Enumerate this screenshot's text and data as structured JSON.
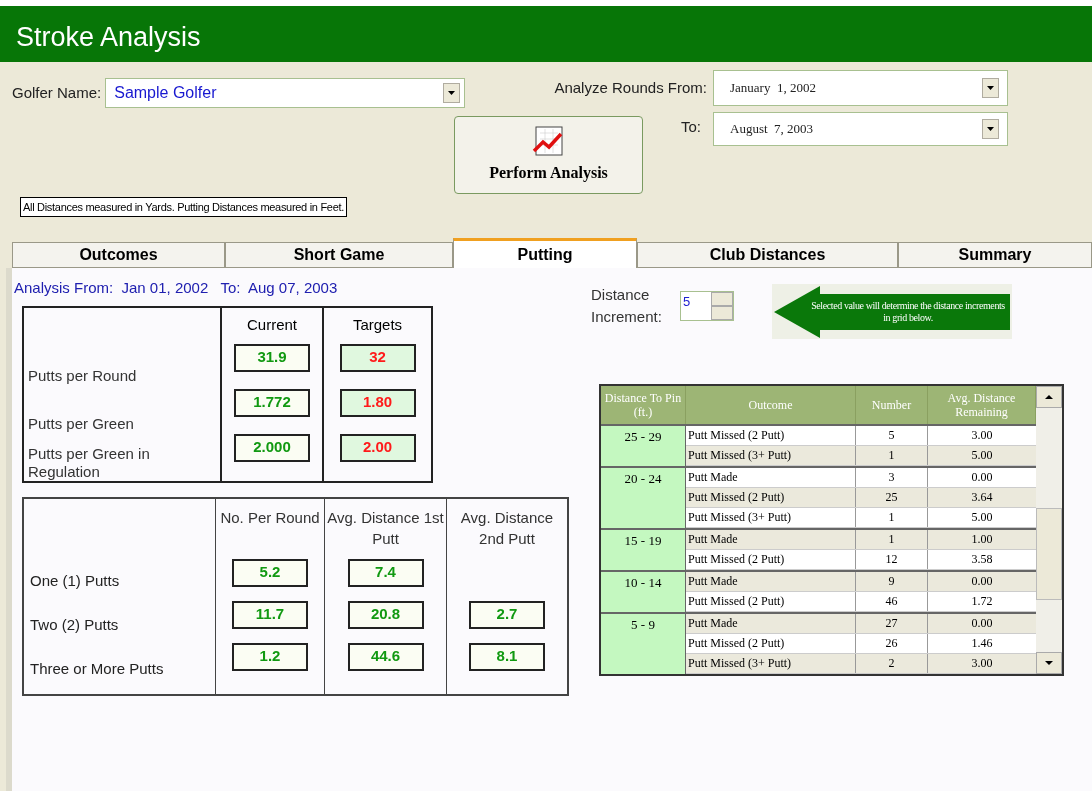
{
  "window": {
    "title": "Stroke Analysis"
  },
  "golfer": {
    "label": "Golfer Name:",
    "value": "Sample Golfer"
  },
  "range": {
    "from_label": "Analyze Rounds From:",
    "from_value": "January  1, 2002",
    "to_label": "To:",
    "to_value": "August  7, 2003"
  },
  "perform_button": "Perform Analysis",
  "note": "All Distances measured in Yards.  Putting Distances measured in Feet.",
  "tabs": [
    {
      "label": "Outcomes",
      "selected": false
    },
    {
      "label": "Short Game",
      "selected": false
    },
    {
      "label": "Putting",
      "selected": true
    },
    {
      "label": "Club Distances",
      "selected": false
    },
    {
      "label": "Summary",
      "selected": false
    }
  ],
  "analysis_period": "Analysis From:  Jan 01, 2002   To:  Aug 07, 2003",
  "putts_table": {
    "columns": [
      "Current",
      "Targets"
    ],
    "rows": [
      {
        "label": "Putts per Round",
        "current": "31.9",
        "target": "32"
      },
      {
        "label": "Putts per Green",
        "current": "1.772",
        "target": "1.80"
      },
      {
        "label": "Putts per Green in Regulation",
        "current": "2.000",
        "target": "2.00"
      }
    ]
  },
  "putt_counts": {
    "columns": [
      "No. Per Round",
      "Avg. Distance 1st Putt",
      "Avg. Distance 2nd Putt"
    ],
    "rows": [
      {
        "label": "One (1) Putts",
        "values": [
          "5.2",
          "7.4"
        ]
      },
      {
        "label": "Two (2) Putts",
        "values": [
          "11.7",
          "20.8",
          "2.7"
        ]
      },
      {
        "label": "Three or More Putts",
        "values": [
          "1.2",
          "44.6",
          "8.1"
        ]
      }
    ]
  },
  "increment": {
    "label": "Distance Increment:",
    "value": "5"
  },
  "hint": "Selected value will determine the distance increments in grid below.",
  "grid": {
    "columns": [
      "Distance To Pin (ft.)",
      "Outcome",
      "Number",
      "Avg. Distance Remaining"
    ],
    "groups": [
      {
        "distance": "25 - 29",
        "rows": [
          {
            "outcome": "Putt Missed (2 Putt)",
            "number": "5",
            "avg": "3.00"
          },
          {
            "outcome": "Putt Missed (3+ Putt)",
            "number": "1",
            "avg": "5.00"
          }
        ]
      },
      {
        "distance": "20 - 24",
        "rows": [
          {
            "outcome": "Putt Made",
            "number": "3",
            "avg": "0.00"
          },
          {
            "outcome": "Putt Missed (2 Putt)",
            "number": "25",
            "avg": "3.64"
          },
          {
            "outcome": "Putt Missed (3+ Putt)",
            "number": "1",
            "avg": "5.00"
          }
        ]
      },
      {
        "distance": "15 - 19",
        "rows": [
          {
            "outcome": "Putt Made",
            "number": "1",
            "avg": "1.00"
          },
          {
            "outcome": "Putt Missed (2 Putt)",
            "number": "12",
            "avg": "3.58"
          }
        ]
      },
      {
        "distance": "10 - 14",
        "rows": [
          {
            "outcome": "Putt Made",
            "number": "9",
            "avg": "0.00"
          },
          {
            "outcome": "Putt Missed (2 Putt)",
            "number": "46",
            "avg": "1.72"
          }
        ]
      },
      {
        "distance": "5 - 9",
        "rows": [
          {
            "outcome": "Putt Made",
            "number": "27",
            "avg": "0.00"
          },
          {
            "outcome": "Putt Missed (2 Putt)",
            "number": "26",
            "avg": "1.46"
          },
          {
            "outcome": "Putt Missed (3+ Putt)",
            "number": "2",
            "avg": "3.00"
          }
        ]
      }
    ]
  }
}
